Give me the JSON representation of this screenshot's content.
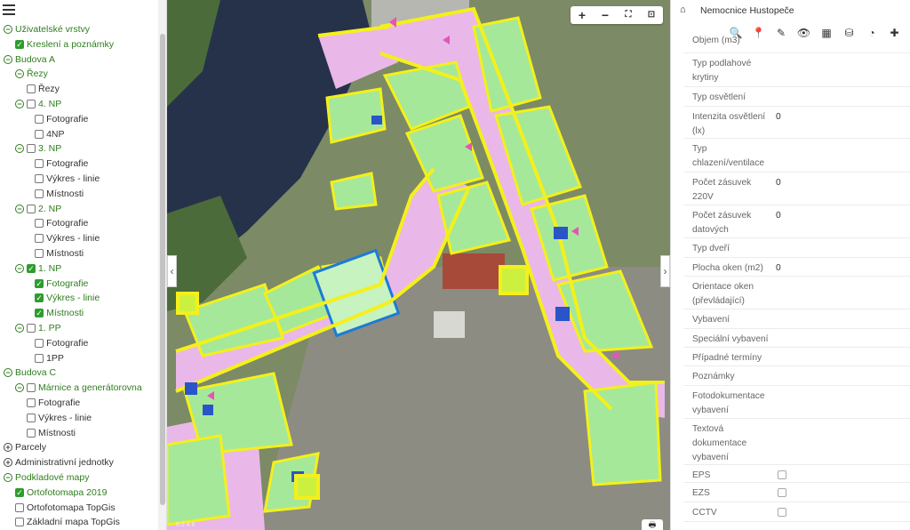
{
  "layers": {
    "items": [
      {
        "indent": 0,
        "icon": "minus",
        "check": null,
        "label": "Uživatelské vrstvy",
        "green": true
      },
      {
        "indent": 1,
        "icon": null,
        "check": true,
        "label": "Kreslení a poznámky",
        "green": true
      },
      {
        "indent": 0,
        "icon": "minus",
        "check": null,
        "label": "Budova A",
        "green": true
      },
      {
        "indent": 1,
        "icon": "minus",
        "check": null,
        "label": "Řezy",
        "green": true
      },
      {
        "indent": 2,
        "icon": null,
        "check": false,
        "label": "Řezy",
        "green": false
      },
      {
        "indent": 1,
        "icon": "minus",
        "check": false,
        "label": "4. NP",
        "green": true
      },
      {
        "indent": 3,
        "icon": null,
        "check": false,
        "label": "Fotografie",
        "green": false
      },
      {
        "indent": 3,
        "icon": null,
        "check": false,
        "label": "4NP",
        "green": false
      },
      {
        "indent": 1,
        "icon": "minus",
        "check": false,
        "label": "3. NP",
        "green": true
      },
      {
        "indent": 3,
        "icon": null,
        "check": false,
        "label": "Fotografie",
        "green": false
      },
      {
        "indent": 3,
        "icon": null,
        "check": false,
        "label": "Výkres - linie",
        "green": false
      },
      {
        "indent": 3,
        "icon": null,
        "check": false,
        "label": "Místnosti",
        "green": false
      },
      {
        "indent": 1,
        "icon": "minus",
        "check": false,
        "label": "2. NP",
        "green": true
      },
      {
        "indent": 3,
        "icon": null,
        "check": false,
        "label": "Fotografie",
        "green": false
      },
      {
        "indent": 3,
        "icon": null,
        "check": false,
        "label": "Výkres - linie",
        "green": false
      },
      {
        "indent": 3,
        "icon": null,
        "check": false,
        "label": "Místnosti",
        "green": false
      },
      {
        "indent": 1,
        "icon": "minus",
        "check": true,
        "label": "1. NP",
        "green": true
      },
      {
        "indent": 3,
        "icon": null,
        "check": true,
        "label": "Fotografie",
        "green": true
      },
      {
        "indent": 3,
        "icon": null,
        "check": true,
        "label": "Výkres - linie",
        "green": true
      },
      {
        "indent": 3,
        "icon": null,
        "check": true,
        "label": "Místnosti",
        "green": true
      },
      {
        "indent": 1,
        "icon": "minus",
        "check": false,
        "label": "1. PP",
        "green": true
      },
      {
        "indent": 3,
        "icon": null,
        "check": false,
        "label": "Fotografie",
        "green": false
      },
      {
        "indent": 3,
        "icon": null,
        "check": false,
        "label": "1PP",
        "green": false
      },
      {
        "indent": 0,
        "icon": "minus",
        "check": null,
        "label": "Budova C",
        "green": true
      },
      {
        "indent": 1,
        "icon": "minus",
        "check": false,
        "label": "Márnice a generátorovna",
        "green": true
      },
      {
        "indent": 2,
        "icon": null,
        "check": false,
        "label": "Fotografie",
        "green": false
      },
      {
        "indent": 2,
        "icon": null,
        "check": false,
        "label": "Výkres - linie",
        "green": false
      },
      {
        "indent": 2,
        "icon": null,
        "check": false,
        "label": "Místnosti",
        "green": false
      },
      {
        "indent": 0,
        "icon": "plus",
        "check": null,
        "label": "Parcely",
        "green": false
      },
      {
        "indent": 0,
        "icon": "plus",
        "check": null,
        "label": "Administrativní jednotky",
        "green": false
      },
      {
        "indent": 0,
        "icon": "minus",
        "check": null,
        "label": "Podkladové mapy",
        "green": true
      },
      {
        "indent": 1,
        "icon": null,
        "check": true,
        "label": "Ortofotomapa 2019",
        "green": true
      },
      {
        "indent": 1,
        "icon": null,
        "check": false,
        "label": "Ortofotomapa TopGis",
        "green": false
      },
      {
        "indent": 1,
        "icon": null,
        "check": false,
        "label": "Základní mapa TopGis",
        "green": false
      }
    ]
  },
  "map": {
    "zoom_in": "+",
    "zoom_out": "−",
    "fullscreen": "⛶",
    "extent": "⊡",
    "collapse_left": "‹",
    "collapse_right": "›",
    "print": "🖶",
    "scale_ticks": "0   2   4   6"
  },
  "panel": {
    "home_icon": "⌂",
    "title": "Nemocnice Hustopeče",
    "tools": [
      "🔍",
      "📍",
      "✎",
      "👁",
      "▦",
      "⛁",
      "◔",
      "✚"
    ],
    "attributes": [
      {
        "key": "Objem (m3)",
        "value": "",
        "h": 14
      },
      {
        "key": "Typ podlahové krytiny",
        "value": "",
        "h": 38
      },
      {
        "key": "Typ osvětlení",
        "value": "",
        "h": 22
      },
      {
        "key": "Intenzita osvětlení (lx)",
        "value": "0",
        "h": 36
      },
      {
        "key": "Typ chlazení/ventilace",
        "value": "",
        "h": 38
      },
      {
        "key": "Počet zásuvek 220V",
        "value": "0",
        "h": 37
      },
      {
        "key": "Počet zásuvek datových",
        "value": "0",
        "h": 37
      },
      {
        "key": "Typ dveří",
        "value": "",
        "h": 22
      },
      {
        "key": "Plocha oken (m2)",
        "value": "0",
        "h": 21
      },
      {
        "key": "Orientace oken (převládající)",
        "value": "",
        "h": 37
      },
      {
        "key": "Vybavení",
        "value": "",
        "h": 22
      },
      {
        "key": "Speciální vybavení",
        "value": "",
        "h": 21
      },
      {
        "key": "Případné termíny",
        "value": "",
        "h": 21
      },
      {
        "key": "Poznámky",
        "value": "",
        "h": 22
      },
      {
        "key": "Fotodokumentace vybavení",
        "value": "",
        "h": 37
      },
      {
        "key": "Textová dokumentace vybavení",
        "value": "",
        "h": 52
      },
      {
        "key": "EPS",
        "value": "",
        "h": 20,
        "checkbox": true
      },
      {
        "key": "EZS",
        "value": "",
        "h": 22,
        "checkbox": true
      },
      {
        "key": "CCTV",
        "value": "",
        "h": 22,
        "checkbox": true
      }
    ]
  },
  "colors": {
    "corridor": "#e9b8e8",
    "room": "#a6e89a",
    "wall": "#f4f01a",
    "water": "#26324a",
    "tree": "#4b6b3a",
    "asphalt": "#8c8c82",
    "roof": "#a84a3a"
  }
}
